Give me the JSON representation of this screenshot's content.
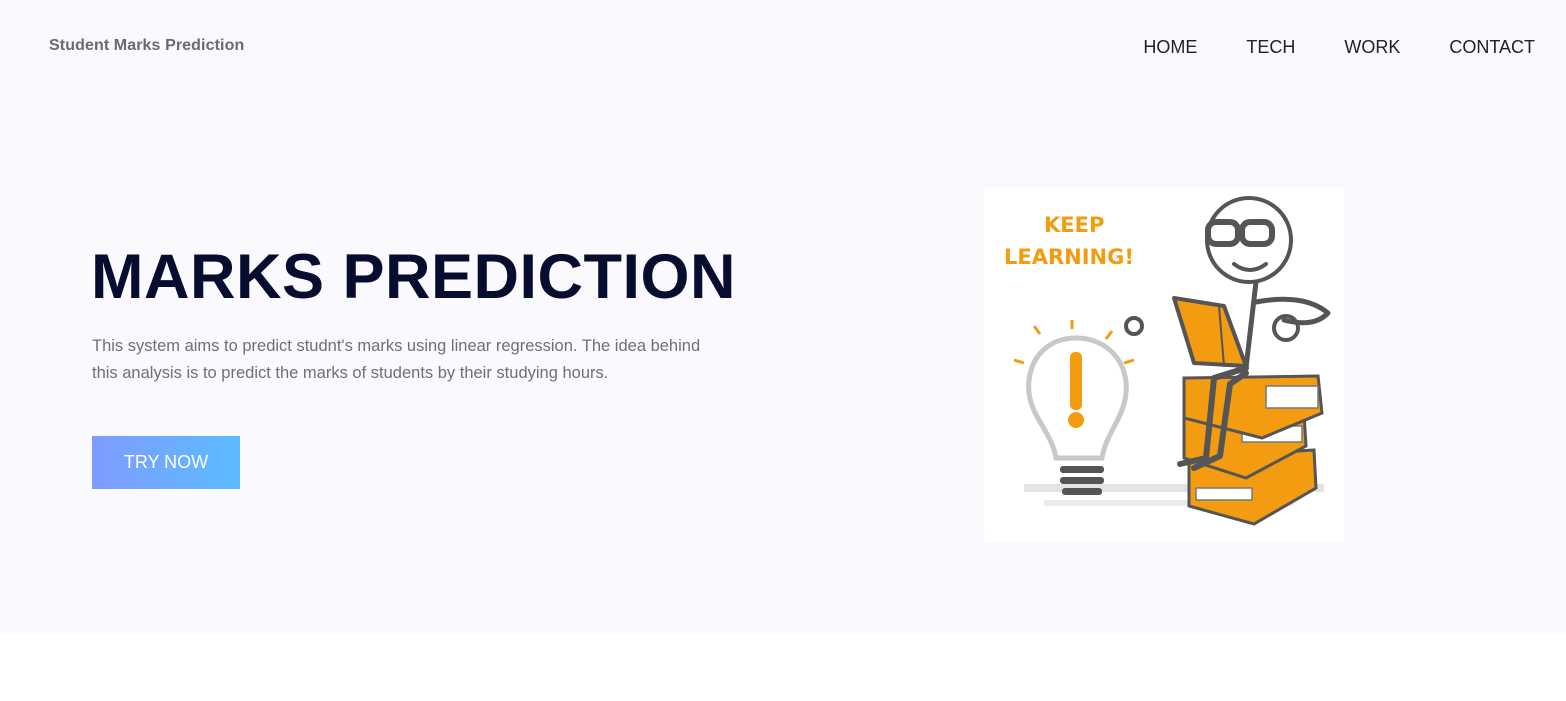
{
  "header": {
    "brand": "Student Marks Prediction",
    "nav": [
      {
        "label": "HOME"
      },
      {
        "label": "TECH"
      },
      {
        "label": "WORK"
      },
      {
        "label": "CONTACT"
      }
    ]
  },
  "hero": {
    "title": "MARKS PREDICTION",
    "description": "This system aims to predict studnt's marks using linear regression. The idea behind this analysis is to predict the marks of students by their studying hours.",
    "cta_label": "TRY NOW",
    "illustration": {
      "text_line1": "KEEP",
      "text_line2": "LEARNING!",
      "icon": "stick-figure-reading-on-books-with-lightbulb"
    }
  },
  "colors": {
    "hero_background": "#f9f9fe",
    "title": "#070d2e",
    "button_gradient_start": "#7f9bff",
    "button_gradient_end": "#5cbcff",
    "illustration_accent": "#f39c12"
  }
}
